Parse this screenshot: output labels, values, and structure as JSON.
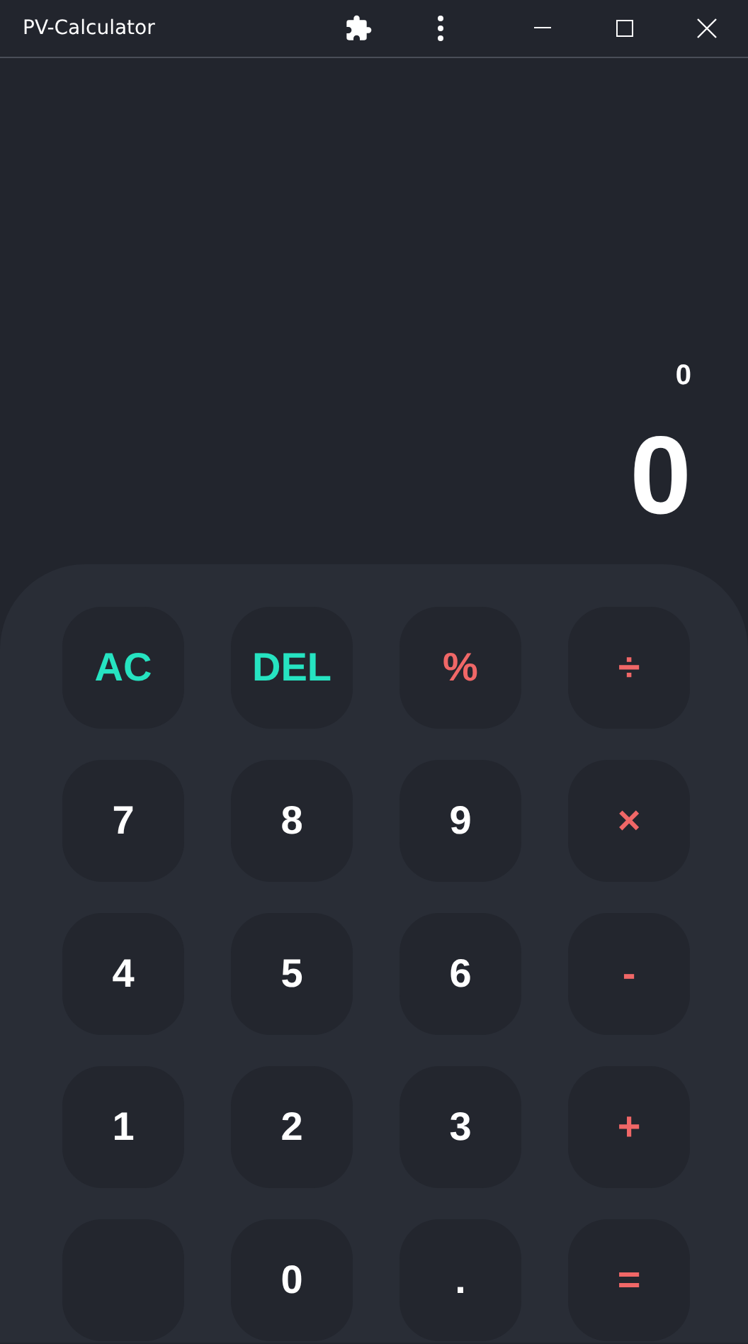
{
  "window": {
    "title": "PV-Calculator"
  },
  "display": {
    "expression": "0",
    "result": "0"
  },
  "keys": [
    {
      "kind": "function",
      "label": "AC"
    },
    {
      "kind": "function",
      "label": "DEL"
    },
    {
      "kind": "operator",
      "label": "%"
    },
    {
      "kind": "operator",
      "label": "÷"
    },
    {
      "kind": "digit",
      "label": "7"
    },
    {
      "kind": "digit",
      "label": "8"
    },
    {
      "kind": "digit",
      "label": "9"
    },
    {
      "kind": "operator",
      "label": "×"
    },
    {
      "kind": "digit",
      "label": "4"
    },
    {
      "kind": "digit",
      "label": "5"
    },
    {
      "kind": "digit",
      "label": "6"
    },
    {
      "kind": "operator",
      "label": "-"
    },
    {
      "kind": "digit",
      "label": "1"
    },
    {
      "kind": "digit",
      "label": "2"
    },
    {
      "kind": "digit",
      "label": "3"
    },
    {
      "kind": "operator",
      "label": "+"
    },
    {
      "kind": "blank"
    },
    {
      "kind": "digit",
      "label": "0"
    },
    {
      "kind": "digit",
      "label": "."
    },
    {
      "kind": "operator",
      "label": "="
    }
  ]
}
